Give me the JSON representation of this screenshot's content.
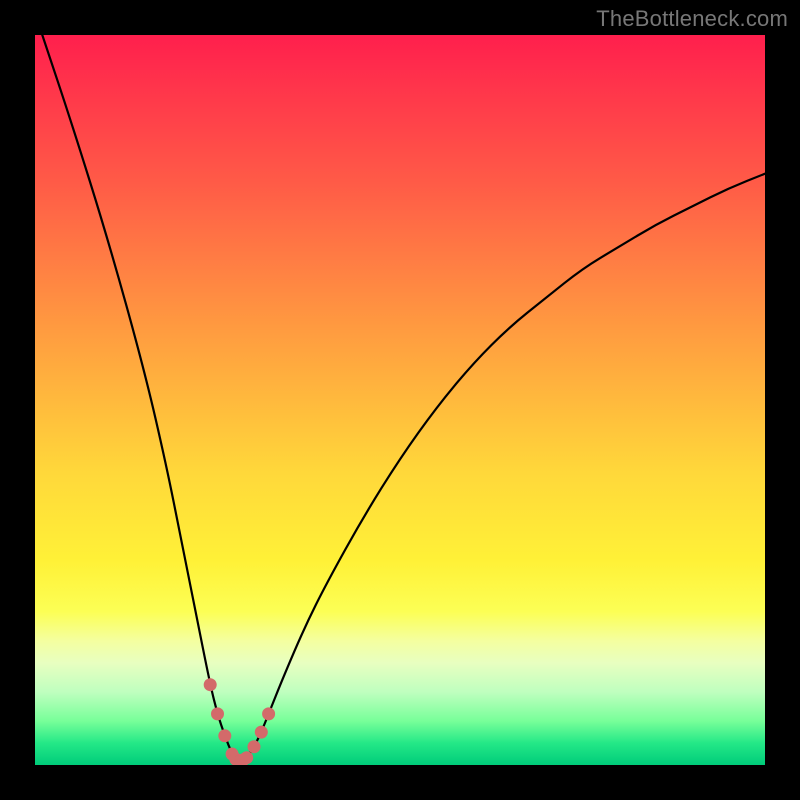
{
  "watermark": "TheBottleneck.com",
  "colors": {
    "background": "#000000",
    "gradient_top": "#ff1f4d",
    "gradient_mid": "#ffd83a",
    "gradient_bottom": "#00cc7a",
    "curve": "#000000",
    "marker": "#d36a6a"
  },
  "chart_data": {
    "type": "line",
    "title": "",
    "xlabel": "",
    "ylabel": "",
    "xlim": [
      0,
      100
    ],
    "ylim": [
      0,
      100
    ],
    "grid": false,
    "legend": false,
    "note": "Values estimated from pixel positions on an unlabeled plot; x is horizontal percent of plot width (left=0), y is vertical percent of plot height (bottom=0). Single V-shaped curve with minimum near x≈28.",
    "series": [
      {
        "name": "bottleneck-curve",
        "x": [
          1,
          5,
          10,
          15,
          18,
          20,
          22,
          24,
          25,
          26,
          27,
          28,
          29,
          30,
          31,
          32,
          34,
          37,
          40,
          45,
          50,
          55,
          60,
          65,
          70,
          75,
          80,
          85,
          90,
          95,
          100
        ],
        "y": [
          100,
          88,
          72,
          54,
          41,
          31,
          21,
          11,
          7,
          4,
          1.5,
          0.5,
          1,
          2.5,
          4.5,
          7,
          12,
          19,
          25,
          34,
          42,
          49,
          55,
          60,
          64,
          68,
          71,
          74,
          76.5,
          79,
          81
        ]
      }
    ],
    "markers": {
      "name": "minimum-highlight",
      "note": "Pink/coral dotted marker segment near bottom of V",
      "x": [
        24,
        25,
        26,
        27,
        27.5,
        28,
        28.5,
        29,
        30,
        31,
        32
      ],
      "y": [
        11,
        7,
        4,
        1.5,
        0.8,
        0.5,
        0.7,
        1,
        2.5,
        4.5,
        7
      ]
    }
  }
}
